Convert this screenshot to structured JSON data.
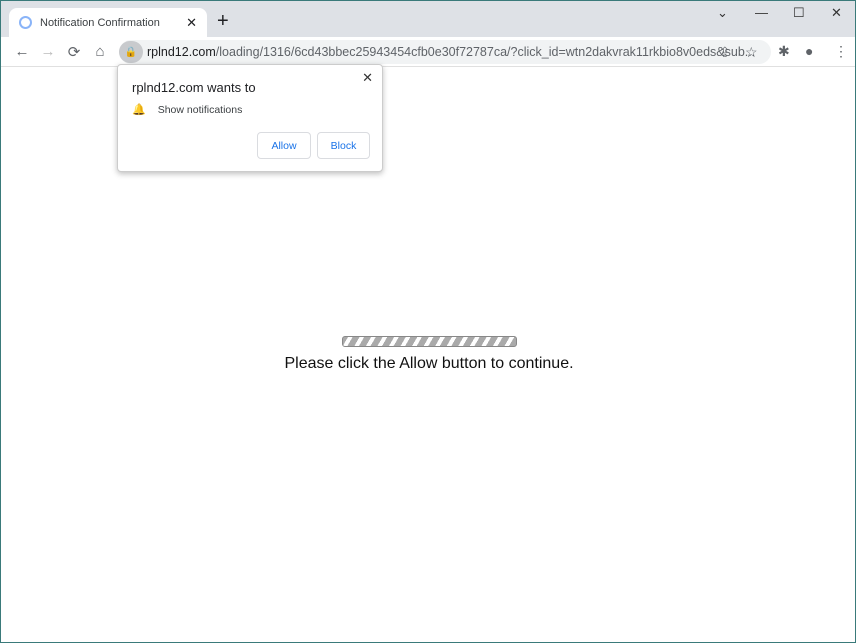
{
  "tab": {
    "title": "Notification Confirmation",
    "close": "✕",
    "new_tab": "+"
  },
  "window": {
    "dropdown": "⌄",
    "minimize": "—",
    "maximize": "☐",
    "close": "✕"
  },
  "nav": {
    "back": "←",
    "forward": "→",
    "reload": "⟳",
    "home": "⌂"
  },
  "address": {
    "domain": "rplnd12.com",
    "path": "/loading/1316/6cd43bbec25943454cfb0e30f72787ca/?click_id=wtn2dakvrak11rkbio8v0eds&sub..."
  },
  "toolbar_icons": {
    "share": "⇪",
    "star": "☆",
    "extensions": "✱",
    "profile": "●",
    "menu": "⋮"
  },
  "permission_popup": {
    "heading": "rplnd12.com wants to",
    "permission": "Show notifications",
    "bell": "🔔",
    "allow": "Allow",
    "block": "Block",
    "close": "✕"
  },
  "page": {
    "progress_style": "indeterminate striped",
    "message": "Please click the Allow button to continue."
  }
}
